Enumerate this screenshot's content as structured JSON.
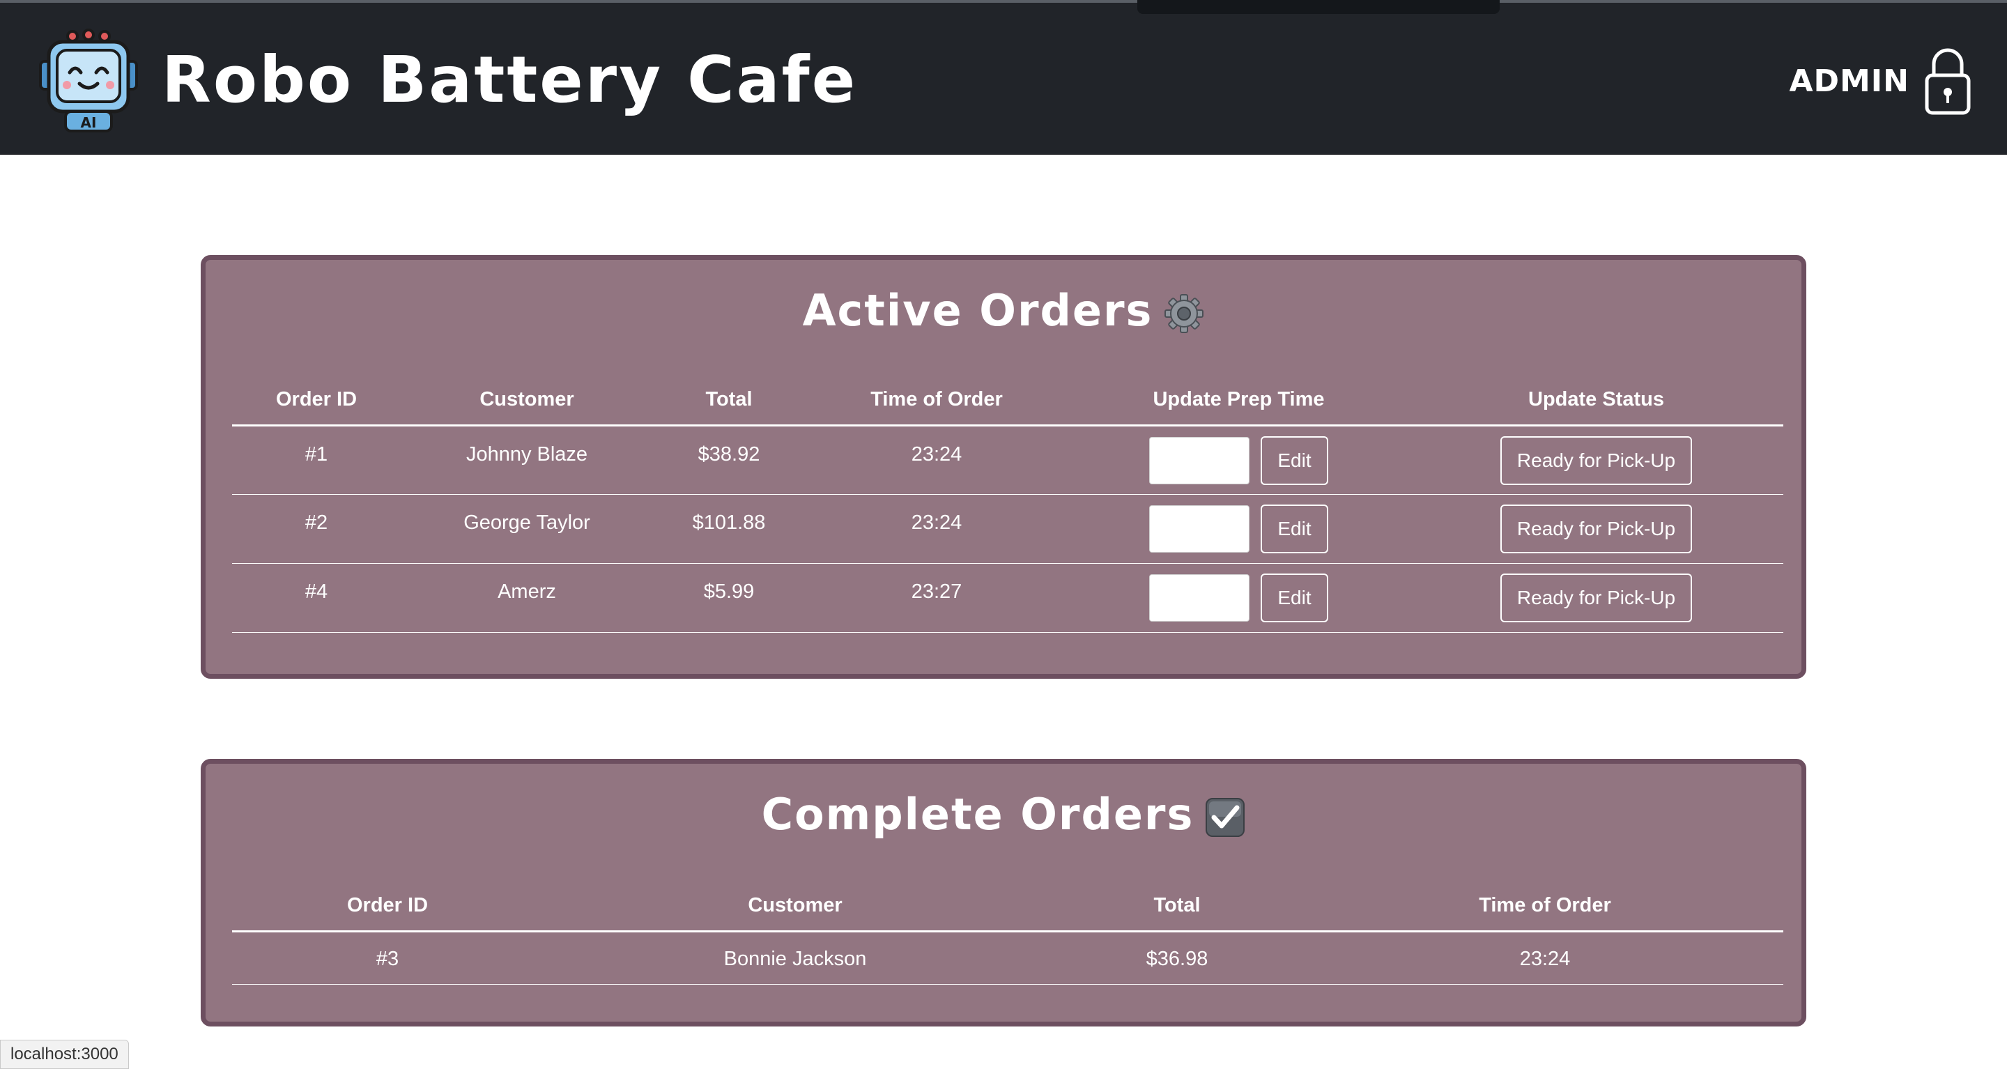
{
  "app": {
    "title": "Robo Battery Cafe",
    "logo_icon": "robot-icon",
    "admin_label": "ADMIN",
    "admin_icon": "lock-icon"
  },
  "colors": {
    "header_bg": "#212429",
    "panel_bg": "#927581",
    "panel_border": "#6d4f60"
  },
  "active_orders": {
    "title": "Active Orders",
    "title_icon": "gear-icon",
    "columns": [
      "Order ID",
      "Customer",
      "Total",
      "Time of Order",
      "Update Prep Time",
      "Update Status"
    ],
    "rows": [
      {
        "id": "#1",
        "customer": "Johnny Blaze",
        "total": "$38.92",
        "time": "23:24",
        "prep_value": "",
        "edit_label": "Edit",
        "status_label": "Ready for Pick-Up"
      },
      {
        "id": "#2",
        "customer": "George Taylor",
        "total": "$101.88",
        "time": "23:24",
        "prep_value": "",
        "edit_label": "Edit",
        "status_label": "Ready for Pick-Up"
      },
      {
        "id": "#4",
        "customer": "Amerz",
        "total": "$5.99",
        "time": "23:27",
        "prep_value": "",
        "edit_label": "Edit",
        "status_label": "Ready for Pick-Up"
      }
    ]
  },
  "complete_orders": {
    "title": "Complete Orders",
    "title_icon": "checkbox-icon",
    "columns": [
      "Order ID",
      "Customer",
      "Total",
      "Time of Order"
    ],
    "rows": [
      {
        "id": "#3",
        "customer": "Bonnie Jackson",
        "total": "$36.98",
        "time": "23:24"
      }
    ]
  },
  "statusbar": {
    "url": "localhost:3000"
  }
}
